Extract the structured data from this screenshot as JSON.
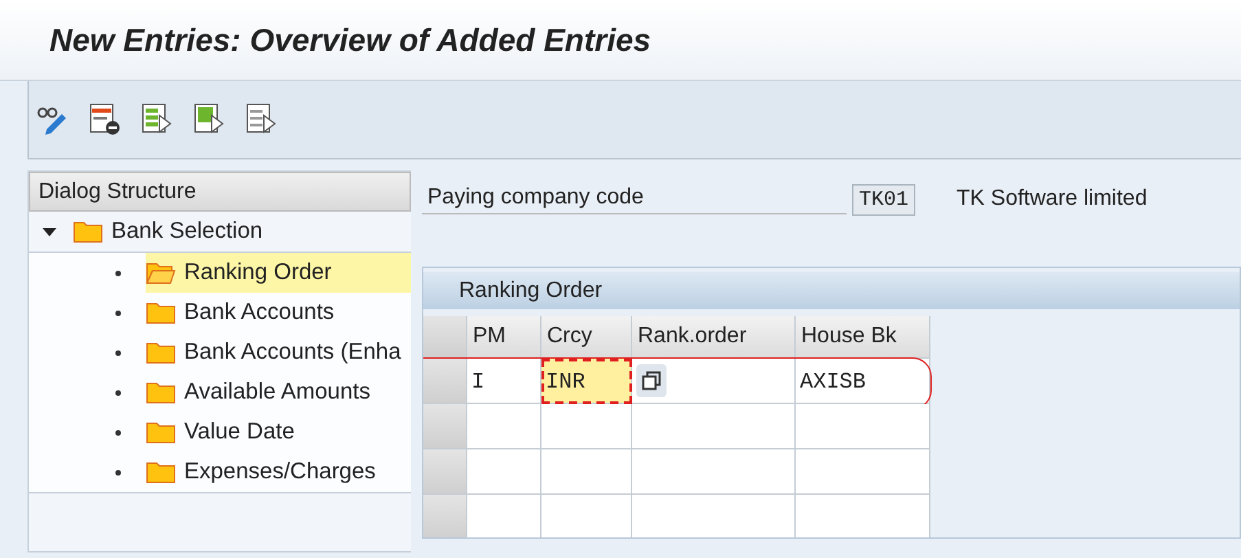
{
  "window": {
    "title": "New Entries: Overview of Added Entries"
  },
  "toolbar": [
    {
      "kind": "glasses-pencil"
    },
    {
      "kind": "delete-rows"
    },
    {
      "kind": "select-all"
    },
    {
      "kind": "select-block"
    },
    {
      "kind": "deselect-all"
    }
  ],
  "dialog_structure": {
    "title": "Dialog Structure",
    "items": [
      {
        "label": "Bank Selection",
        "expanded": true,
        "selected": false,
        "children": [
          {
            "label": "Ranking Order",
            "selected": true
          },
          {
            "label": "Bank Accounts",
            "selected": false
          },
          {
            "label": "Bank Accounts (Enha",
            "selected": false
          },
          {
            "label": "Available Amounts",
            "selected": false
          },
          {
            "label": "Value Date",
            "selected": false
          },
          {
            "label": "Expenses/Charges",
            "selected": false
          }
        ]
      }
    ]
  },
  "header_fields": [
    {
      "label": "Paying company code",
      "value": "TK01",
      "description": "TK Software limited"
    }
  ],
  "table": {
    "title": "Ranking Order",
    "columns": [
      "PM",
      "Crcy",
      "Rank.order",
      "House Bk"
    ],
    "rows": [
      {
        "kind": "entry",
        "highlighted": true,
        "cells": [
          {
            "value": "I",
            "focused": false
          },
          {
            "value": "INR",
            "focused": true
          },
          {
            "kind": "button",
            "focused": false
          },
          {
            "value": "AXISB",
            "focused": false
          }
        ]
      },
      {
        "kind": "empty",
        "highlighted": false
      },
      {
        "kind": "empty",
        "highlighted": false
      },
      {
        "kind": "empty",
        "highlighted": false
      }
    ]
  }
}
